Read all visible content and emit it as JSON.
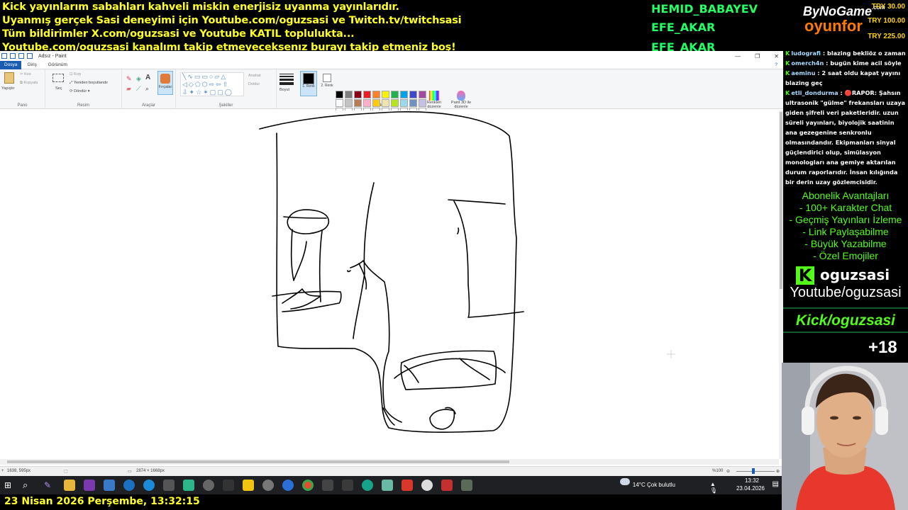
{
  "banner": {
    "line1": "Kick yayınlarım sabahları kahveli miskin enerjisiz uyanma yayınlarıdır.",
    "line2": "Uyanmış gerçek Sasi deneyimi için Youtube.com/oguzsasi ve Twitch.tv/twitchsasi",
    "line3": "Tüm bildirimler X.com/oguzsasi ve Youtube KATIL toplulukta...",
    "line4": "Youtube.com/oguzsasi kanalımı takip etmeyeceksenız burayı takip etmeniz boş!"
  },
  "donors": [
    "HEMID_BABAYEV",
    "EFE_AKAR",
    "EFE_AKAR"
  ],
  "brand": {
    "name": "ByNoGame",
    "com": ".com",
    "name2": "oyunfor",
    "prices": [
      "TRY 30.00",
      "TRY 100.00",
      "TRY 225.00"
    ]
  },
  "paint": {
    "title": "Adsız - Paint",
    "menu": {
      "file": "Dosya",
      "home": "Giriş",
      "view": "Görünüm"
    },
    "ribbon": {
      "paste": "Yapıştır",
      "cut": "Kes",
      "copy": "Kopyala",
      "clipboard": "Pano",
      "select": "Seç",
      "crop": "Kırp",
      "resize": "Yeniden boyutlandır",
      "rotate": "Döndür",
      "image": "Resim",
      "tools": "Araçlar",
      "brushes": "Fırçalar",
      "shapes": "Şekiller",
      "outline": "Anahat",
      "fill": "Doldur",
      "size": "Boyut",
      "color1": "1. Renk",
      "color2": "2. Renk",
      "colors": "Renkler",
      "edit_colors": "Renkleri düzenle",
      "paint3d": "Paint 3D ile düzenle"
    },
    "status": {
      "cursor": "1638, 595px",
      "size": "2874 × 1668px",
      "zoom": "%100"
    }
  },
  "chat": [
    {
      "user": "ludografi",
      "text": "blazing bekliöz o zaman"
    },
    {
      "user": "omerch4n",
      "text": "bugün kime acil söyle"
    },
    {
      "user": "aeminu",
      "text": "2 saat oldu kapat yayını blazing geç"
    },
    {
      "user": "etli_dondurma",
      "text": "🔴RAPOR: Şahsın ultrasonik \"gülme\" frekansları uzaya giden şifreli veri paketleridir. uzun süreli yayınları, biyolojik saatinin ana gezegenine senkronlu olmasındandır. Ekipmanları sinyal güçlendirici olup, simülasyon monologları ana gemiye aktarılan durum raporlarıdır. İnsan kılığında bir derin uzay gözlemcisidir."
    }
  ],
  "perks": {
    "title": "Abonelik Avantajları",
    "items": [
      "- 100+ Karakter Chat",
      "- Geçmiş Yayınları İzleme",
      "- Link Paylaşabilme",
      "- Büyük Yazabilme",
      "- Özel Emojiler"
    ]
  },
  "socials": {
    "kick_logo": "K",
    "kick_name": "oguzsasi",
    "youtube": "Youtube/oguzsasi",
    "kick_url": "Kick/oguzsasi",
    "age": "+18"
  },
  "taskbar": {
    "weather": "14°C  Çok bulutlu",
    "time": "13:32",
    "date": "23.04.2026"
  },
  "clock": "23 Nisan 2026 Perşembe, 13:32:15",
  "colors": {
    "palette": [
      "#000000",
      "#7f7f7f",
      "#880015",
      "#ed1c24",
      "#ff7f27",
      "#fff200",
      "#22b14c",
      "#00a2e8",
      "#3f48cc",
      "#a349a4",
      "#ffffff",
      "#c3c3c3",
      "#b97a57",
      "#ffaec9",
      "#ffc90e",
      "#efe4b0",
      "#b5e61d",
      "#99d9ea",
      "#7092be",
      "#c8bfe7",
      "#ffffff",
      "#ffffff",
      "#ffffff",
      "#ffffff",
      "#ffffff",
      "#ffffff",
      "#ffffff",
      "#ffffff",
      "#ffffff",
      "#ffffff"
    ]
  }
}
